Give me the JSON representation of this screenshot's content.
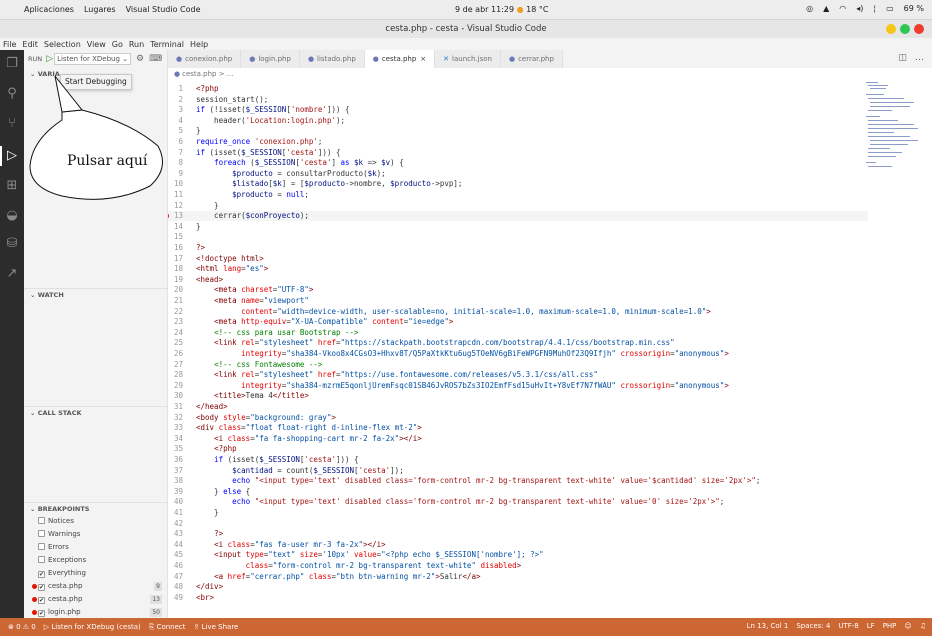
{
  "system": {
    "apps_label": "Aplicaciones",
    "places_label": "Lugares",
    "active_app": "Visual Studio Code",
    "datetime": "9 de abr 11:29",
    "weather": "18 °C",
    "battery": "69 %"
  },
  "window": {
    "title": "cesta.php - cesta - Visual Studio Code"
  },
  "menu": [
    "File",
    "Edit",
    "Selection",
    "View",
    "Go",
    "Run",
    "Terminal",
    "Help"
  ],
  "debug": {
    "run_label": "RUN",
    "config_label": "Listen for XDebug",
    "variables_label": "VARIA",
    "tooltip": "Start Debugging",
    "watch_label": "WATCH",
    "callstack_label": "CALL STACK",
    "breakpoints_label": "BREAKPOINTS",
    "breakpoints": [
      {
        "label": "Notices",
        "checked": false
      },
      {
        "label": "Warnings",
        "checked": false
      },
      {
        "label": "Errors",
        "checked": false
      },
      {
        "label": "Exceptions",
        "checked": false
      },
      {
        "label": "Everything",
        "checked": true
      },
      {
        "label": "cesta.php",
        "checked": true,
        "count": "9",
        "dot": true
      },
      {
        "label": "cesta.php",
        "checked": true,
        "count": "13",
        "dot": true
      },
      {
        "label": "login.php",
        "checked": true,
        "count": "50",
        "dot": true
      }
    ]
  },
  "tabs": [
    {
      "label": "conexion.php",
      "active": false
    },
    {
      "label": "login.php",
      "active": false
    },
    {
      "label": "listado.php",
      "active": false
    },
    {
      "label": "cesta.php",
      "active": true
    },
    {
      "label": "launch.json",
      "active": false,
      "json": true
    },
    {
      "label": "cerrar.php",
      "active": false
    }
  ],
  "breadcrumb": "cesta.php > ...",
  "callout": "Pulsar aquí",
  "code": [
    {
      "n": "1",
      "html": "<span class='t'>&lt;?php</span>"
    },
    {
      "n": "2",
      "html": "session_start();"
    },
    {
      "n": "3",
      "html": "<span class='k'>if</span> (!isset(<span class='v'>$_SESSION</span>[<span class='s'>'nombre'</span>])) {"
    },
    {
      "n": "4",
      "html": "    header(<span class='s'>'Location:login.php'</span>);"
    },
    {
      "n": "5",
      "html": "}"
    },
    {
      "n": "6",
      "html": "<span class='k'>require_once</span> <span class='s'>'conexion.php'</span>;"
    },
    {
      "n": "7",
      "html": "<span class='k'>if</span> (isset(<span class='v'>$_SESSION</span>[<span class='s'>'cesta'</span>])) {"
    },
    {
      "n": "8",
      "html": "    <span class='k'>foreach</span> (<span class='v'>$_SESSION</span>[<span class='s'>'cesta'</span>] <span class='k'>as</span> <span class='v'>$k</span> =&gt; <span class='v'>$v</span>) {"
    },
    {
      "n": "9",
      "html": "        <span class='v'>$producto</span> = consultarProducto(<span class='v'>$k</span>);"
    },
    {
      "n": "10",
      "html": "        <span class='v'>$listado</span>[<span class='v'>$k</span>] = [<span class='v'>$producto</span>-&gt;nombre, <span class='v'>$producto</span>-&gt;pvp];"
    },
    {
      "n": "11",
      "html": "        <span class='v'>$producto</span> = <span class='k'>null</span>;"
    },
    {
      "n": "12",
      "html": "    }"
    },
    {
      "n": "13",
      "html": "    cerrar(<span class='v'>$conProyecto</span>);",
      "bp": true,
      "current": true
    },
    {
      "n": "14",
      "html": "}"
    },
    {
      "n": "15",
      "html": ""
    },
    {
      "n": "16",
      "html": "<span class='t'>?&gt;</span>"
    },
    {
      "n": "17",
      "html": "<span class='t'>&lt;!doctype html&gt;</span>"
    },
    {
      "n": "18",
      "html": "<span class='t'>&lt;html</span> <span class='a'>lang</span>=<span class='sb'>\"es\"</span><span class='t'>&gt;</span>"
    },
    {
      "n": "19",
      "html": "<span class='t'>&lt;head&gt;</span>"
    },
    {
      "n": "20",
      "html": "    <span class='t'>&lt;meta</span> <span class='a'>charset</span>=<span class='sb'>\"UTF-8\"</span><span class='t'>&gt;</span>"
    },
    {
      "n": "21",
      "html": "    <span class='t'>&lt;meta</span> <span class='a'>name</span>=<span class='sb'>\"viewport\"</span>"
    },
    {
      "n": "22",
      "html": "          <span class='a'>content</span>=<span class='sb'>\"width=device-width, user-scalable=no, initial-scale=1.0, maximum-scale=1.0, minimum-scale=1.0\"</span><span class='t'>&gt;</span>"
    },
    {
      "n": "23",
      "html": "    <span class='t'>&lt;meta</span> <span class='a'>http-equiv</span>=<span class='sb'>\"X-UA-Compatible\"</span> <span class='a'>content</span>=<span class='sb'>\"ie=edge\"</span><span class='t'>&gt;</span>"
    },
    {
      "n": "24",
      "html": "    <span class='c'>&lt;!-- css para usar Bootstrap --&gt;</span>"
    },
    {
      "n": "25",
      "html": "    <span class='t'>&lt;link</span> <span class='a'>rel</span>=<span class='sb'>\"stylesheet\"</span> <span class='a'>href</span>=<span class='sb'>\"https://stackpath.bootstrapcdn.com/bootstrap/4.4.1/css/bootstrap.min.css\"</span>"
    },
    {
      "n": "26",
      "html": "          <span class='a'>integrity</span>=<span class='sb'>\"sha384-Vkoo8x4CGsO3+Hhxv8T/Q5PaXtkKtu6ug5TOeNV6gBiFeWPGFN9MuhOf23Q9Ifjh\"</span> <span class='a'>crossorigin</span>=<span class='sb'>\"anonymous\"</span><span class='t'>&gt;</span>"
    },
    {
      "n": "27",
      "html": "    <span class='c'>&lt;!-- css Fontawesome --&gt;</span>"
    },
    {
      "n": "28",
      "html": "    <span class='t'>&lt;link</span> <span class='a'>rel</span>=<span class='sb'>\"stylesheet\"</span> <span class='a'>href</span>=<span class='sb'>\"https://use.fontawesome.com/releases/v5.3.1/css/all.css\"</span>"
    },
    {
      "n": "29",
      "html": "          <span class='a'>integrity</span>=<span class='sb'>\"sha384-mzrmE5qonljUremFsqc01SB46JvROS7bZs3IO2EmfFsd15uHvIt+Y8vEf7N7fWAU\"</span> <span class='a'>crossorigin</span>=<span class='sb'>\"anonymous\"</span><span class='t'>&gt;</span>"
    },
    {
      "n": "30",
      "html": "    <span class='t'>&lt;title&gt;</span>Tema 4<span class='t'>&lt;/title&gt;</span>"
    },
    {
      "n": "31",
      "html": "<span class='t'>&lt;/head&gt;</span>"
    },
    {
      "n": "32",
      "html": "<span class='t'>&lt;body</span> <span class='a'>style</span>=<span class='sb'>\"background: gray\"</span><span class='t'>&gt;</span>"
    },
    {
      "n": "33",
      "html": "<span class='t'>&lt;div</span> <span class='a'>class</span>=<span class='sb'>\"float float-right d-inline-flex mt-2\"</span><span class='t'>&gt;</span>"
    },
    {
      "n": "34",
      "html": "    <span class='t'>&lt;i</span> <span class='a'>class</span>=<span class='sb'>\"fa fa-shopping-cart mr-2 fa-2x\"</span><span class='t'>&gt;&lt;/i&gt;</span>"
    },
    {
      "n": "35",
      "html": "    <span class='t'>&lt;?php</span>"
    },
    {
      "n": "36",
      "html": "    <span class='k'>if</span> (isset(<span class='v'>$_SESSION</span>[<span class='s'>'cesta'</span>])) {"
    },
    {
      "n": "37",
      "html": "        <span class='v'>$cantidad</span> = count(<span class='v'>$_SESSION</span>[<span class='s'>'cesta'</span>]);"
    },
    {
      "n": "38",
      "html": "        <span class='k'>echo</span> <span class='s'>\"&lt;input type='text' disabled class='form-control mr-2 bg-transparent text-white' value='$cantidad' size='2px'&gt;\"</span>;"
    },
    {
      "n": "39",
      "html": "    } <span class='k'>else</span> {"
    },
    {
      "n": "40",
      "html": "        <span class='k'>echo</span> <span class='s'>\"&lt;input type='text' disabled class='form-control mr-2 bg-transparent text-white' value='0' size='2px'&gt;\"</span>;"
    },
    {
      "n": "41",
      "html": "    }"
    },
    {
      "n": "42",
      "html": ""
    },
    {
      "n": "43",
      "html": "    <span class='t'>?&gt;</span>"
    },
    {
      "n": "44",
      "html": "    <span class='t'>&lt;i</span> <span class='a'>class</span>=<span class='sb'>\"fas fa-user mr-3 fa-2x\"</span><span class='t'>&gt;&lt;/i&gt;</span>"
    },
    {
      "n": "45",
      "html": "    <span class='t'>&lt;input</span> <span class='a'>type</span>=<span class='sb'>\"text\"</span> <span class='a'>size</span>=<span class='sb'>'10px'</span> <span class='a'>value</span>=<span class='sb'>\"&lt;?php echo $_SESSION['nombre']; ?&gt;\"</span>"
    },
    {
      "n": "46",
      "html": "           <span class='a'>class</span>=<span class='sb'>\"form-control mr-2 bg-transparent text-white\"</span> <span class='a'>disabled</span><span class='t'>&gt;</span>"
    },
    {
      "n": "47",
      "html": "    <span class='t'>&lt;a</span> <span class='a'>href</span>=<span class='sb'>\"cerrar.php\"</span> <span class='a'>class</span>=<span class='sb'>\"btn btn-warning mr-2\"</span><span class='t'>&gt;</span>Salir<span class='t'>&lt;/a&gt;</span>"
    },
    {
      "n": "48",
      "html": "<span class='t'>&lt;/div&gt;</span>"
    },
    {
      "n": "49",
      "html": "<span class='t'>&lt;br&gt;</span>"
    }
  ],
  "status": {
    "problems": "⊗ 0 ⚠ 0",
    "debug_config": "▷ Listen for XDebug (cesta)",
    "connect": "Connect",
    "live_share": "Live Share",
    "position": "Ln 13, Col 1",
    "spaces": "Spaces: 4",
    "encoding": "UTF-8",
    "eol": "LF",
    "language": "PHP"
  },
  "colors": {
    "status_bar": "#cc6633",
    "activity_bar": "#2c2c2c",
    "breakpoint": "#e51400"
  }
}
